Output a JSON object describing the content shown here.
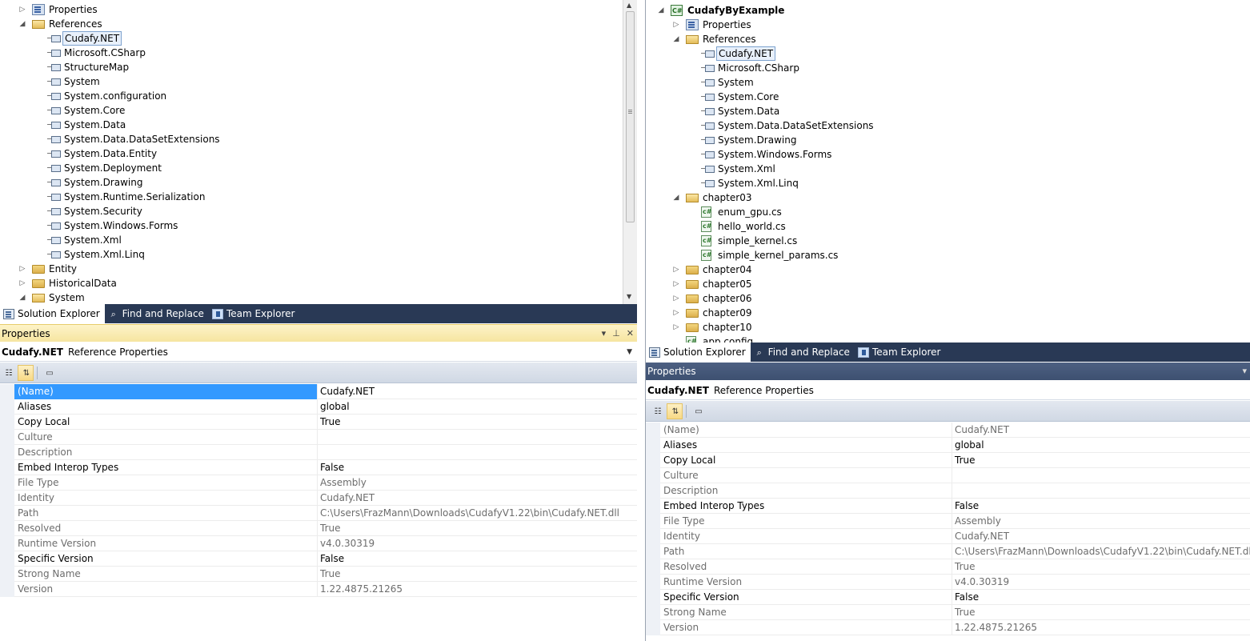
{
  "left": {
    "tree": [
      {
        "label": "Properties",
        "icon": "properties-icon",
        "arrow": "collapsed",
        "level": 0
      },
      {
        "label": "References",
        "icon": "folder-open-icon",
        "arrow": "expanded",
        "level": 0
      },
      {
        "label": "Cudafy.NET",
        "icon": "reference-icon",
        "arrow": "none",
        "level": 1,
        "selected": true
      },
      {
        "label": "Microsoft.CSharp",
        "icon": "reference-icon",
        "arrow": "none",
        "level": 1
      },
      {
        "label": "StructureMap",
        "icon": "reference-icon",
        "arrow": "none",
        "level": 1
      },
      {
        "label": "System",
        "icon": "reference-icon",
        "arrow": "none",
        "level": 1
      },
      {
        "label": "System.configuration",
        "icon": "reference-icon",
        "arrow": "none",
        "level": 1
      },
      {
        "label": "System.Core",
        "icon": "reference-icon",
        "arrow": "none",
        "level": 1
      },
      {
        "label": "System.Data",
        "icon": "reference-icon",
        "arrow": "none",
        "level": 1
      },
      {
        "label": "System.Data.DataSetExtensions",
        "icon": "reference-icon",
        "arrow": "none",
        "level": 1
      },
      {
        "label": "System.Data.Entity",
        "icon": "reference-icon",
        "arrow": "none",
        "level": 1
      },
      {
        "label": "System.Deployment",
        "icon": "reference-icon",
        "arrow": "none",
        "level": 1
      },
      {
        "label": "System.Drawing",
        "icon": "reference-icon",
        "arrow": "none",
        "level": 1
      },
      {
        "label": "System.Runtime.Serialization",
        "icon": "reference-icon",
        "arrow": "none",
        "level": 1
      },
      {
        "label": "System.Security",
        "icon": "reference-icon",
        "arrow": "none",
        "level": 1
      },
      {
        "label": "System.Windows.Forms",
        "icon": "reference-icon",
        "arrow": "none",
        "level": 1
      },
      {
        "label": "System.Xml",
        "icon": "reference-icon",
        "arrow": "none",
        "level": 1
      },
      {
        "label": "System.Xml.Linq",
        "icon": "reference-icon",
        "arrow": "none",
        "level": 1
      },
      {
        "label": "Entity",
        "icon": "folder-icon",
        "arrow": "collapsed",
        "level": 0
      },
      {
        "label": "HistoricalData",
        "icon": "folder-icon",
        "arrow": "collapsed",
        "level": 0
      },
      {
        "label": "System",
        "icon": "folder-open-icon",
        "arrow": "expanded",
        "level": 0
      }
    ],
    "tabs": [
      "Solution Explorer",
      "Find and Replace",
      "Team Explorer"
    ],
    "panel_title": "Properties",
    "object_name": "Cudafy.NET",
    "object_type": "Reference Properties"
  },
  "right": {
    "tree": [
      {
        "label": "CudafyByExample",
        "icon": "csharp-project-icon",
        "arrow": "expanded",
        "level": 0,
        "bold": true
      },
      {
        "label": "Properties",
        "icon": "properties-icon",
        "arrow": "collapsed",
        "level": 1
      },
      {
        "label": "References",
        "icon": "folder-open-icon",
        "arrow": "expanded",
        "level": 1
      },
      {
        "label": "Cudafy.NET",
        "icon": "reference-icon",
        "arrow": "none",
        "level": 2,
        "selected": true
      },
      {
        "label": "Microsoft.CSharp",
        "icon": "reference-icon",
        "arrow": "none",
        "level": 2
      },
      {
        "label": "System",
        "icon": "reference-icon",
        "arrow": "none",
        "level": 2
      },
      {
        "label": "System.Core",
        "icon": "reference-icon",
        "arrow": "none",
        "level": 2
      },
      {
        "label": "System.Data",
        "icon": "reference-icon",
        "arrow": "none",
        "level": 2
      },
      {
        "label": "System.Data.DataSetExtensions",
        "icon": "reference-icon",
        "arrow": "none",
        "level": 2
      },
      {
        "label": "System.Drawing",
        "icon": "reference-icon",
        "arrow": "none",
        "level": 2
      },
      {
        "label": "System.Windows.Forms",
        "icon": "reference-icon",
        "arrow": "none",
        "level": 2
      },
      {
        "label": "System.Xml",
        "icon": "reference-icon",
        "arrow": "none",
        "level": 2
      },
      {
        "label": "System.Xml.Linq",
        "icon": "reference-icon",
        "arrow": "none",
        "level": 2
      },
      {
        "label": "chapter03",
        "icon": "folder-open-icon",
        "arrow": "expanded",
        "level": 1
      },
      {
        "label": "enum_gpu.cs",
        "icon": "csharp-file-icon",
        "arrow": "none",
        "level": 2
      },
      {
        "label": "hello_world.cs",
        "icon": "csharp-file-icon",
        "arrow": "none",
        "level": 2
      },
      {
        "label": "simple_kernel.cs",
        "icon": "csharp-file-icon",
        "arrow": "none",
        "level": 2
      },
      {
        "label": "simple_kernel_params.cs",
        "icon": "csharp-file-icon",
        "arrow": "none",
        "level": 2
      },
      {
        "label": "chapter04",
        "icon": "folder-icon",
        "arrow": "collapsed",
        "level": 1
      },
      {
        "label": "chapter05",
        "icon": "folder-icon",
        "arrow": "collapsed",
        "level": 1
      },
      {
        "label": "chapter06",
        "icon": "folder-icon",
        "arrow": "collapsed",
        "level": 1
      },
      {
        "label": "chapter09",
        "icon": "folder-icon",
        "arrow": "collapsed",
        "level": 1
      },
      {
        "label": "chapter10",
        "icon": "folder-icon",
        "arrow": "collapsed",
        "level": 1
      },
      {
        "label": "app.config",
        "icon": "config-file-icon",
        "arrow": "none",
        "level": 1,
        "clipped": true
      }
    ],
    "tabs": [
      "Solution Explorer",
      "Find and Replace",
      "Team Explorer"
    ],
    "panel_title": "Properties",
    "object_name": "Cudafy.NET",
    "object_type": "Reference Properties"
  },
  "properties": [
    {
      "name": "(Name)",
      "value": "Cudafy.NET",
      "readonly": false
    },
    {
      "name": "Aliases",
      "value": "global",
      "readonly": false
    },
    {
      "name": "Copy Local",
      "value": "True",
      "readonly": false
    },
    {
      "name": "Culture",
      "value": "",
      "readonly": true
    },
    {
      "name": "Description",
      "value": "",
      "readonly": true
    },
    {
      "name": "Embed Interop Types",
      "value": "False",
      "readonly": false
    },
    {
      "name": "File Type",
      "value": "Assembly",
      "readonly": true
    },
    {
      "name": "Identity",
      "value": "Cudafy.NET",
      "readonly": true
    },
    {
      "name": "Path",
      "value": "C:\\Users\\FrazMann\\Downloads\\CudafyV1.22\\bin\\Cudafy.NET.dll",
      "readonly": true
    },
    {
      "name": "Resolved",
      "value": "True",
      "readonly": true
    },
    {
      "name": "Runtime Version",
      "value": "v4.0.30319",
      "readonly": true
    },
    {
      "name": "Specific Version",
      "value": "False",
      "readonly": false
    },
    {
      "name": "Strong Name",
      "value": "True",
      "readonly": true
    },
    {
      "name": "Version",
      "value": "1.22.4875.21265",
      "readonly": true
    }
  ],
  "colors": {
    "tab_strip": "#293955",
    "selection": "#3399ff",
    "readonly_text": "#6d6d6d"
  }
}
